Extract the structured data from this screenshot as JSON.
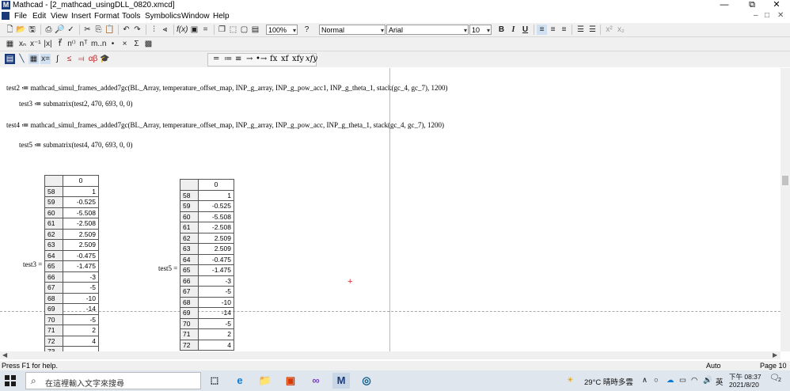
{
  "window": {
    "title": "Mathcad - [2_mathcad_usingDLL_0820.xmcd]",
    "app_icon": "M",
    "controls": {
      "minimize": "—",
      "maximize": "⧉",
      "close": "✕"
    }
  },
  "menu": {
    "items": [
      "File",
      "Edit",
      "View",
      "Insert",
      "Format",
      "Tools",
      "Symbolics",
      "Window",
      "Help"
    ],
    "doc_controls": [
      "–",
      "□",
      "✕"
    ]
  },
  "toolbar": {
    "zoom": "100%",
    "style": "Normal",
    "font": "Arial",
    "size": "10",
    "bold": "B",
    "italic": "I",
    "underline": "U"
  },
  "math_palette": {
    "items": [
      "=",
      "≔",
      "≡",
      "→",
      "•→",
      "fx",
      "xf",
      "xfy",
      "xfy"
    ]
  },
  "worksheet": {
    "expr1": "test2 ≔ mathcad_simul_frames_added7gc(BL_Array, temperature_offset_map, INP_g_array, INP_g_pow_acc1, INP_g_theta_1, stack(gc_4, gc_7), 1200)",
    "expr2": "test3 ≔ submatrix(test2, 470, 693, 0, 0)",
    "expr3": "test4 ≔ mathcad_simul_frames_added7gc(BL_Array, temperature_offset_map, INP_g_array, INP_g_pow_acc, INP_g_theta_1, stack(gc_4, gc_7), 1200)",
    "expr4": "test5 ≔ submatrix(test4, 470, 693, 0, 0)",
    "matrix_left": {
      "label": "test3 =",
      "col_header": "0",
      "indices": [
        "58",
        "59",
        "60",
        "61",
        "62",
        "63",
        "64",
        "65",
        "66",
        "67",
        "68",
        "69",
        "70",
        "71",
        "72",
        "73"
      ],
      "values": [
        "1",
        "-0.525",
        "-5.508",
        "-2.508",
        "2.509",
        "2.509",
        "-0.475",
        "-1.475",
        "-3",
        "-5",
        "-10",
        "-14",
        "-5",
        "2",
        "4",
        ""
      ]
    },
    "matrix_right": {
      "label": "test5 =",
      "col_header": "0",
      "indices": [
        "58",
        "59",
        "60",
        "61",
        "62",
        "63",
        "64",
        "65",
        "66",
        "67",
        "68",
        "69",
        "70",
        "71",
        "72"
      ],
      "values": [
        "1",
        "-0.525",
        "-5.508",
        "-2.508",
        "2.509",
        "2.509",
        "-0.475",
        "-1.475",
        "-3",
        "-5",
        "-10",
        "-14",
        "-5",
        "2",
        "4"
      ]
    }
  },
  "statusbar": {
    "help": "Press F1 for help.",
    "mode": "Auto",
    "page": "Page 10"
  },
  "taskbar": {
    "search_placeholder": "在這裡輸入文字來搜尋",
    "weather": "29°C 晴時多雲",
    "ime": "英",
    "time": "下午 08:37",
    "date": "2021/8/20",
    "notifications": "2"
  },
  "colors": {
    "taskbar_bg": "#dfe6ee",
    "mathcad_blue": "#1a3a7a",
    "cursor_red": "#e02020"
  }
}
